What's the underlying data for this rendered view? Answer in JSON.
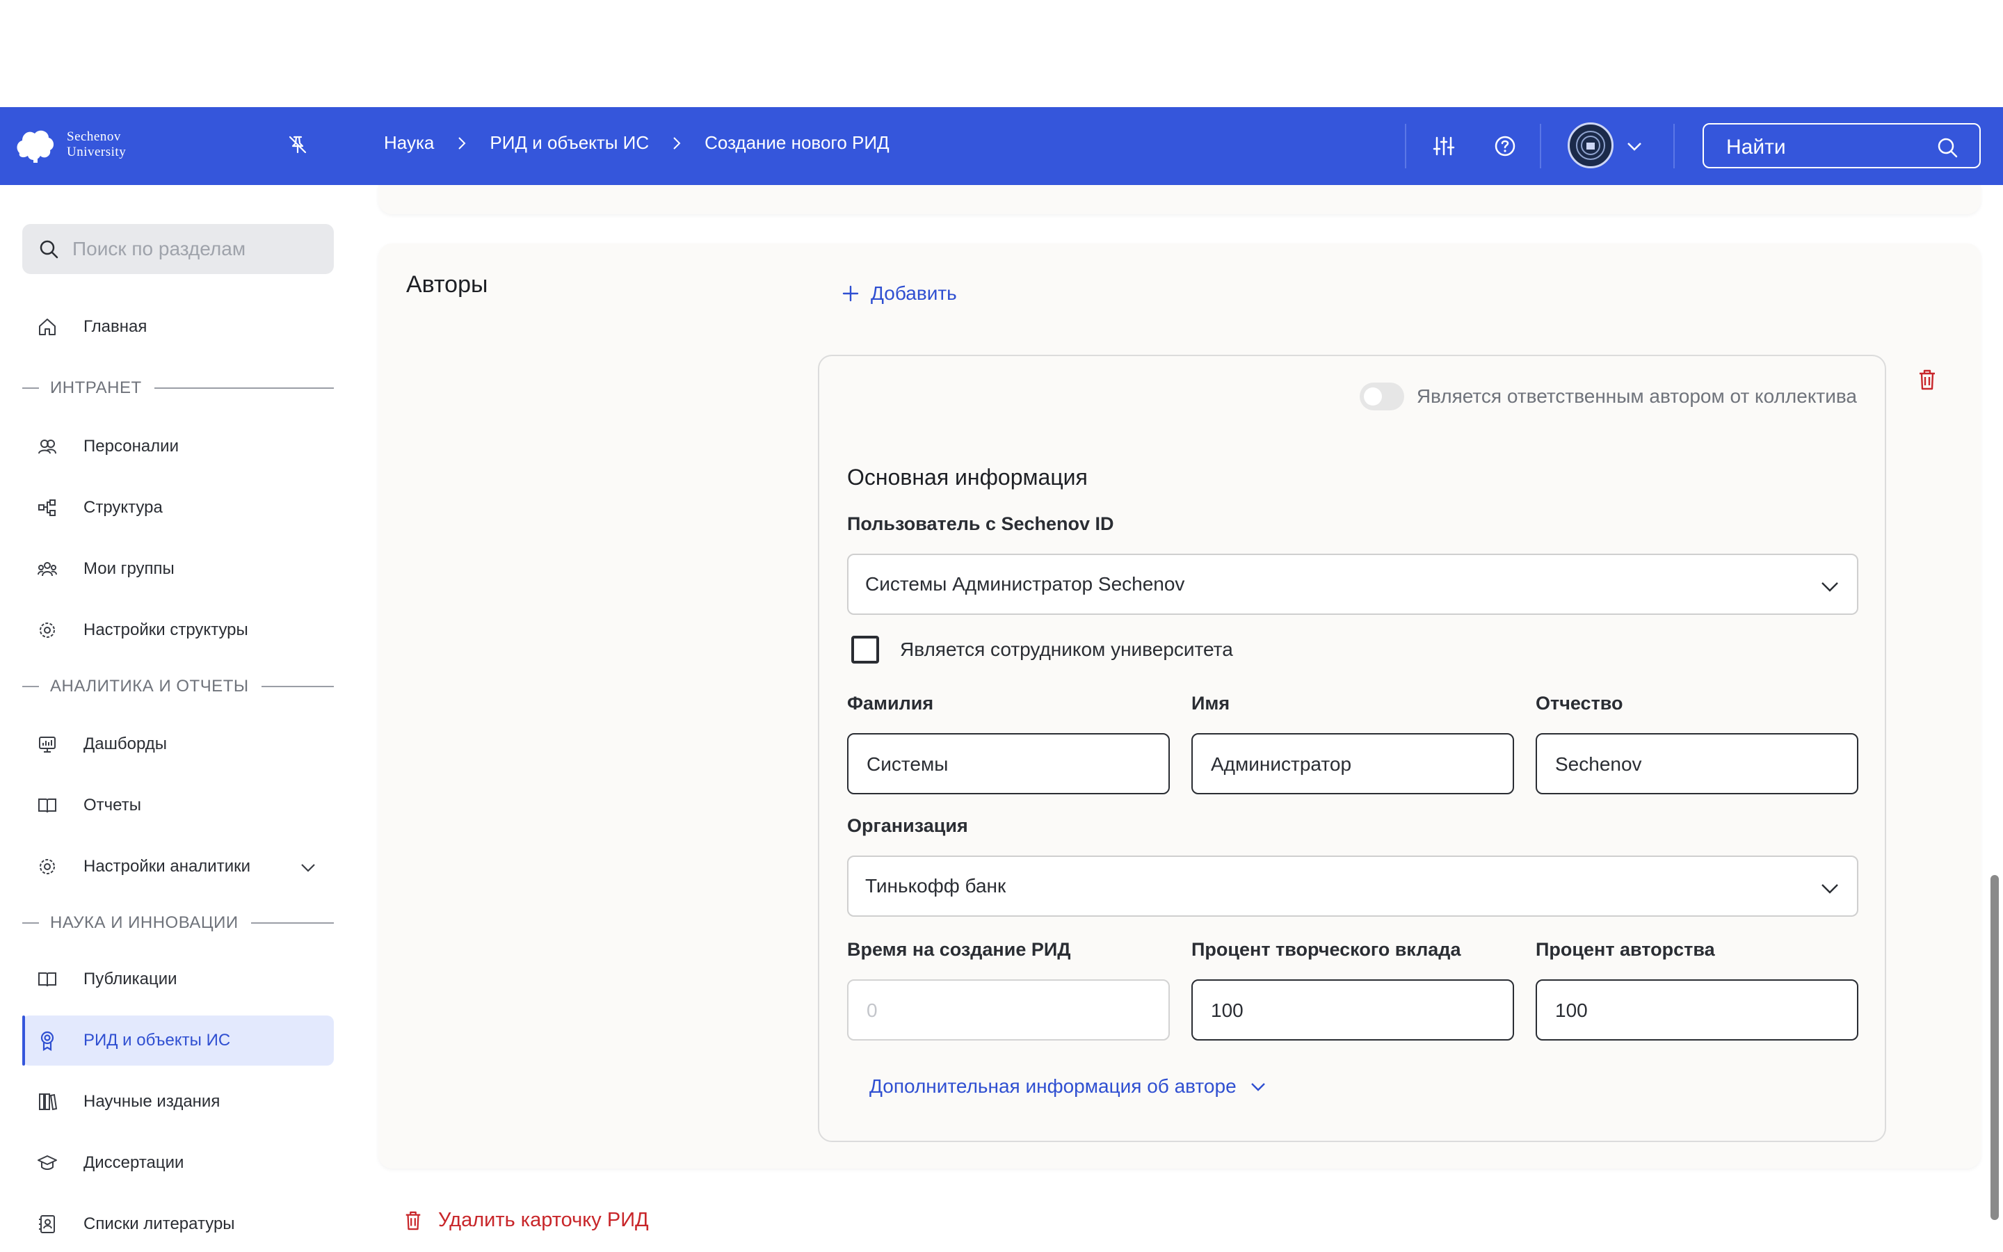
{
  "header": {
    "logo_line1": "Sechenov",
    "logo_line2": "University",
    "breadcrumbs": [
      "Наука",
      "РИД и объекты ИС",
      "Создание нового РИД"
    ],
    "search_placeholder": "Найти"
  },
  "sidebar": {
    "search_placeholder": "Поиск по разделам",
    "home": "Главная",
    "section_intranet": "ИНТРАНЕТ",
    "intranet_items": [
      "Персоналии",
      "Структура",
      "Мои группы",
      "Настройки структуры"
    ],
    "section_analytics": "АНАЛИТИКА И ОТЧЕТЫ",
    "analytics_items": [
      "Дашборды",
      "Отчеты",
      "Настройки аналитики"
    ],
    "section_science": "НАУКА И ИННОВАЦИИ",
    "science_items": [
      "Публикации",
      "РИД и объекты ИС",
      "Научные издания",
      "Диссертации",
      "Списки литературы"
    ],
    "active_item": "РИД и объекты ИС"
  },
  "authors": {
    "title": "Авторы",
    "add_label": "Добавить",
    "responsible_label": "Является ответственным автором от коллектива",
    "responsible_on": false,
    "basic_info": "Основная информация",
    "user_label": "Пользователь с Sechenov ID",
    "user_value": "Системы Администратор Sechenov",
    "employee_label": "Является сотрудником университета",
    "employee_checked": false,
    "surname_label": "Фамилия",
    "surname_value": "Системы",
    "name_label": "Имя",
    "name_value": "Администратор",
    "patronymic_label": "Отчество",
    "patronymic_value": "Sechenov",
    "org_label": "Организация",
    "org_value": "Тинькофф банк",
    "time_label": "Время на создание РИД",
    "time_placeholder": "0",
    "creative_label": "Процент творческого вклада",
    "creative_value": "100",
    "authorship_label": "Процент авторства",
    "authorship_value": "100",
    "more_info": "Дополнительная информация об авторе"
  },
  "delete_card": "Удалить карточку РИД",
  "colors": {
    "brand": "#3556db",
    "link": "#2f4fd1",
    "danger": "#c8262a",
    "active_bg": "#e3e9fd"
  }
}
